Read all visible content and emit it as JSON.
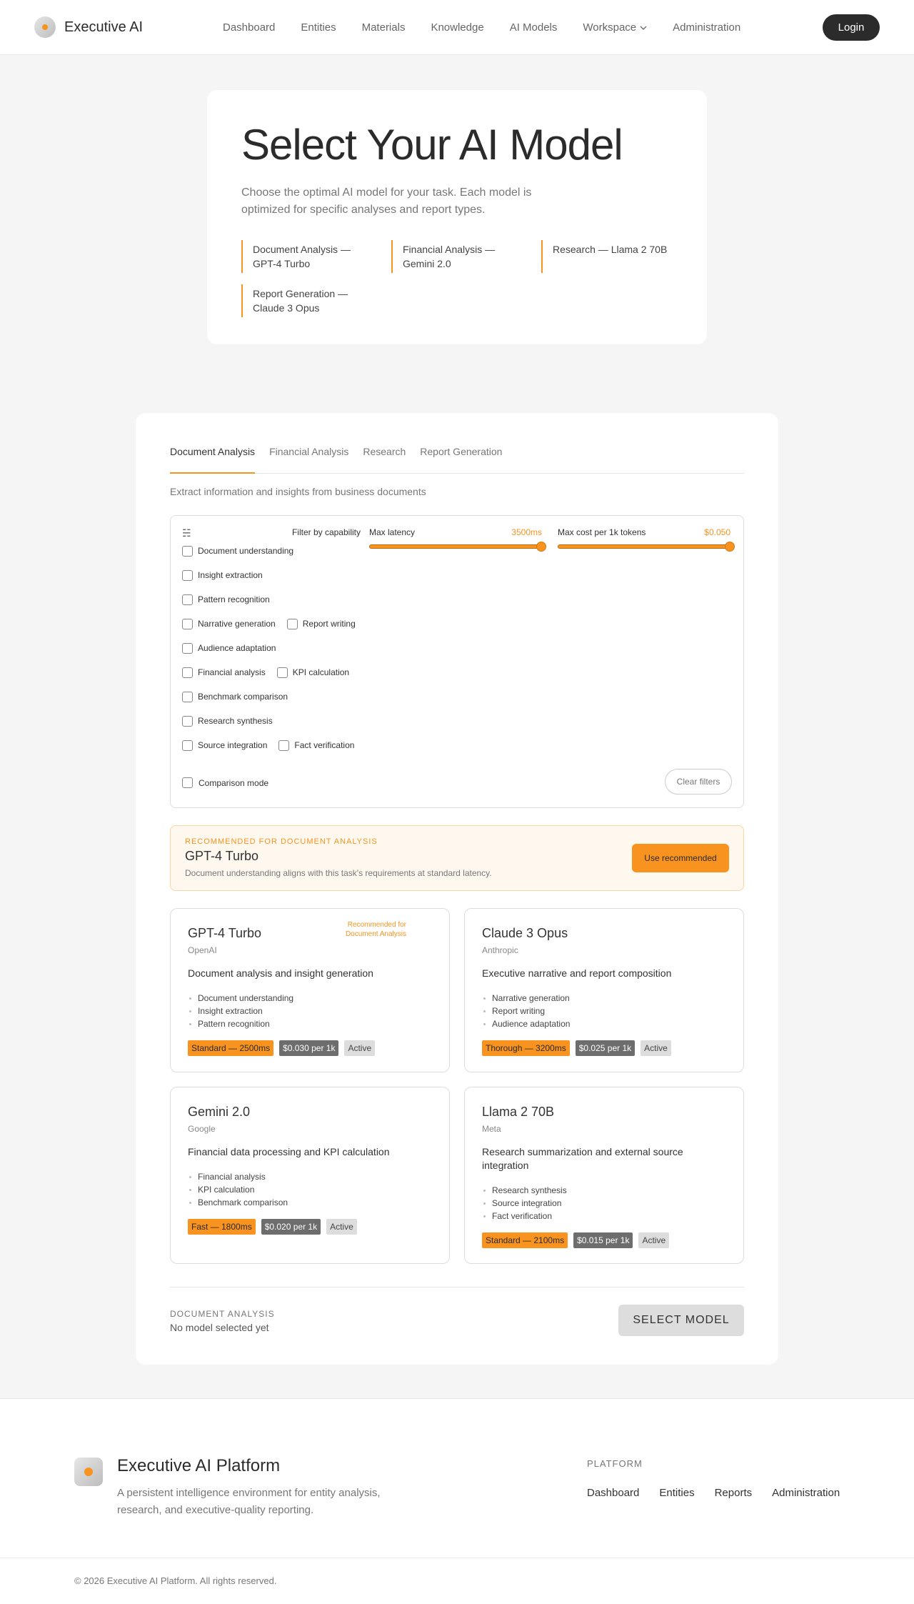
{
  "nav": {
    "brand": "Executive AI",
    "links": [
      "Dashboard",
      "Entities",
      "Materials",
      "Knowledge",
      "AI Models",
      "Workspace",
      "Administration"
    ],
    "login_label": "Login"
  },
  "hero": {
    "title": "Select Your AI Model",
    "subtitle": "Choose the optimal AI model for your task. Each model is optimized for specific analyses and report types.",
    "tags": [
      "Document Analysis — GPT-4 Turbo",
      "Financial Analysis — Gemini 2.0",
      "Research — Llama 2 70B",
      "Report Generation — Claude 3 Opus"
    ]
  },
  "tabs": {
    "items": [
      "Document Analysis",
      "Financial Analysis",
      "Research",
      "Report Generation"
    ],
    "active": 0,
    "description": "Extract information and insights from business documents"
  },
  "filters": {
    "title": "Filter by capability",
    "capabilities": [
      "Document understanding",
      "Insight extraction",
      "Pattern recognition",
      "Narrative generation",
      "Report writing",
      "Audience adaptation",
      "Financial analysis",
      "KPI calculation",
      "Benchmark comparison",
      "Research synthesis",
      "Source integration",
      "Fact verification"
    ],
    "latency": {
      "label": "Max latency",
      "value": "3500ms",
      "fraction": 1.0
    },
    "cost": {
      "label": "Max cost per 1k tokens",
      "value": "$0.050",
      "fraction": 1.0
    },
    "comparison_label": "Comparison mode",
    "clear_label": "Clear filters"
  },
  "recommended": {
    "label": "RECOMMENDED FOR DOCUMENT ANALYSIS",
    "name": "GPT-4 Turbo",
    "description": "Document understanding aligns with this task's requirements at standard latency.",
    "button": "Use recommended"
  },
  "models": [
    {
      "name": "GPT-4 Turbo",
      "provider": "OpenAI",
      "recommend_note": "Recommended for Document Analysis",
      "description": "Document analysis and insight generation",
      "capabilities": [
        "Document understanding",
        "Insight extraction",
        "Pattern recognition"
      ],
      "speed": "Standard — 2500ms",
      "cost": "$0.030 per 1k",
      "status": "Active"
    },
    {
      "name": "Claude 3 Opus",
      "provider": "Anthropic",
      "description": "Executive narrative and report composition",
      "capabilities": [
        "Narrative generation",
        "Report writing",
        "Audience adaptation"
      ],
      "speed": "Thorough — 3200ms",
      "cost": "$0.025 per 1k",
      "status": "Active"
    },
    {
      "name": "Gemini 2.0",
      "provider": "Google",
      "description": "Financial data processing and KPI calculation",
      "capabilities": [
        "Financial analysis",
        "KPI calculation",
        "Benchmark comparison"
      ],
      "speed": "Fast — 1800ms",
      "cost": "$0.020 per 1k",
      "status": "Active"
    },
    {
      "name": "Llama 2 70B",
      "provider": "Meta",
      "description": "Research summarization and external source integration",
      "capabilities": [
        "Research synthesis",
        "Source integration",
        "Fact verification"
      ],
      "speed": "Standard — 2100ms",
      "cost": "$0.015 per 1k",
      "status": "Active"
    }
  ],
  "selection": {
    "label": "DOCUMENT ANALYSIS",
    "value": "No model selected yet",
    "button": "SELECT MODEL"
  },
  "footer": {
    "title": "Executive AI Platform",
    "description": "A persistent intelligence environment for entity analysis, research, and executive-quality reporting.",
    "heading": "PLATFORM",
    "links": [
      "Dashboard",
      "Entities",
      "Reports",
      "Administration"
    ],
    "copyright": "© 2026 Executive AI Platform. All rights reserved."
  },
  "colors": {
    "accent": "#f7931e",
    "dark": "#2b2b2b"
  },
  "icons": {
    "filter": "filter-icon",
    "workspace": "chevron-down-icon"
  }
}
